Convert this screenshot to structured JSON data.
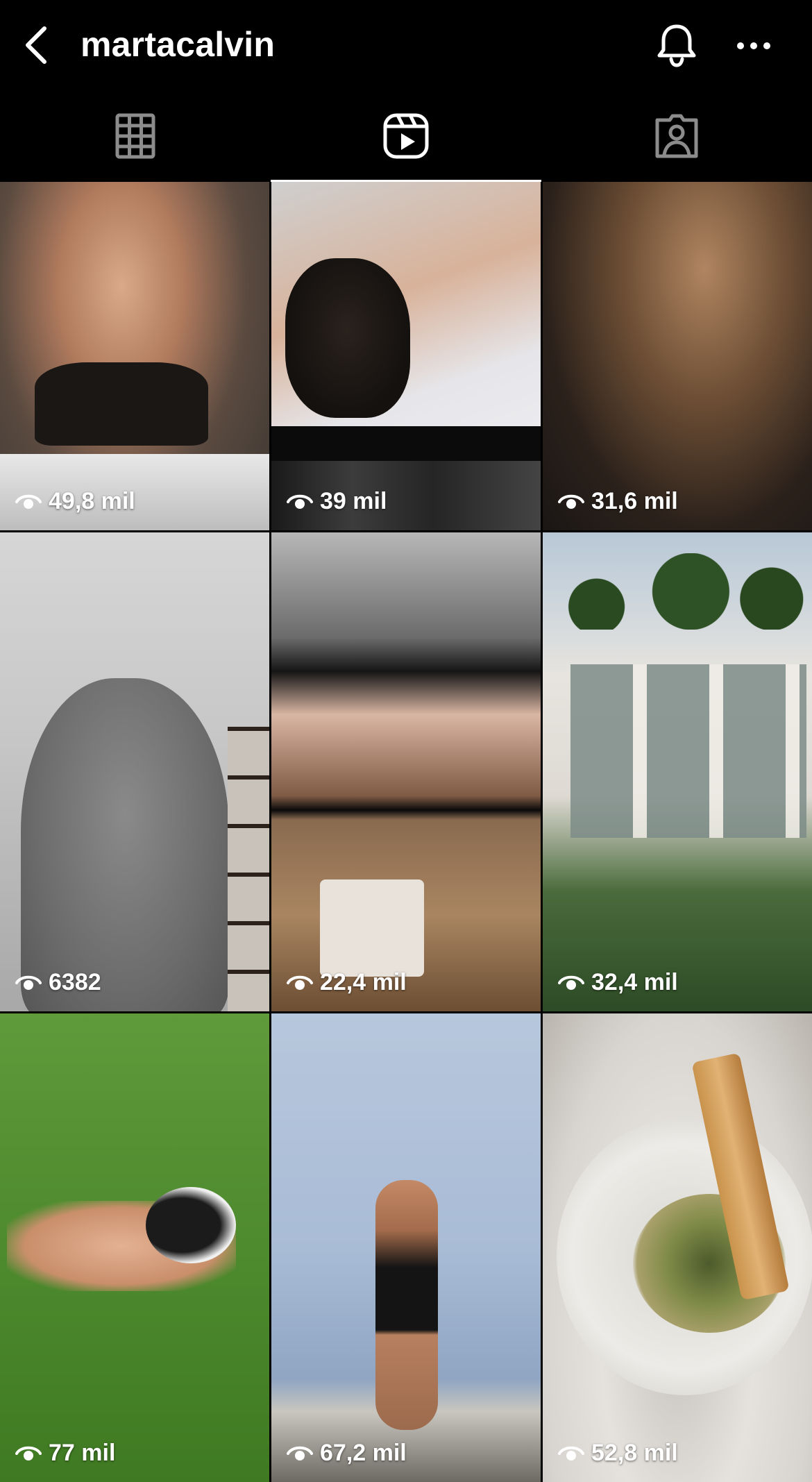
{
  "header": {
    "username": "martacalvin",
    "back_icon": "chevron-left-icon",
    "bell_icon": "bell-icon",
    "more_icon": "more-horizontal-icon"
  },
  "tabs": [
    {
      "name": "grid",
      "icon": "grid-icon",
      "active": false
    },
    {
      "name": "reels",
      "icon": "reels-icon",
      "active": true
    },
    {
      "name": "tagged",
      "icon": "tagged-icon",
      "active": false
    }
  ],
  "reels": [
    {
      "views": "49,8 mil"
    },
    {
      "views": "39 mil"
    },
    {
      "views": "31,6 mil"
    },
    {
      "views": "6382"
    },
    {
      "views": "22,4 mil"
    },
    {
      "views": "32,4 mil"
    },
    {
      "views": "77 mil"
    },
    {
      "views": "67,2 mil"
    },
    {
      "views": "52,8 mil"
    }
  ],
  "colors": {
    "background": "#000000",
    "text": "#ffffff"
  }
}
